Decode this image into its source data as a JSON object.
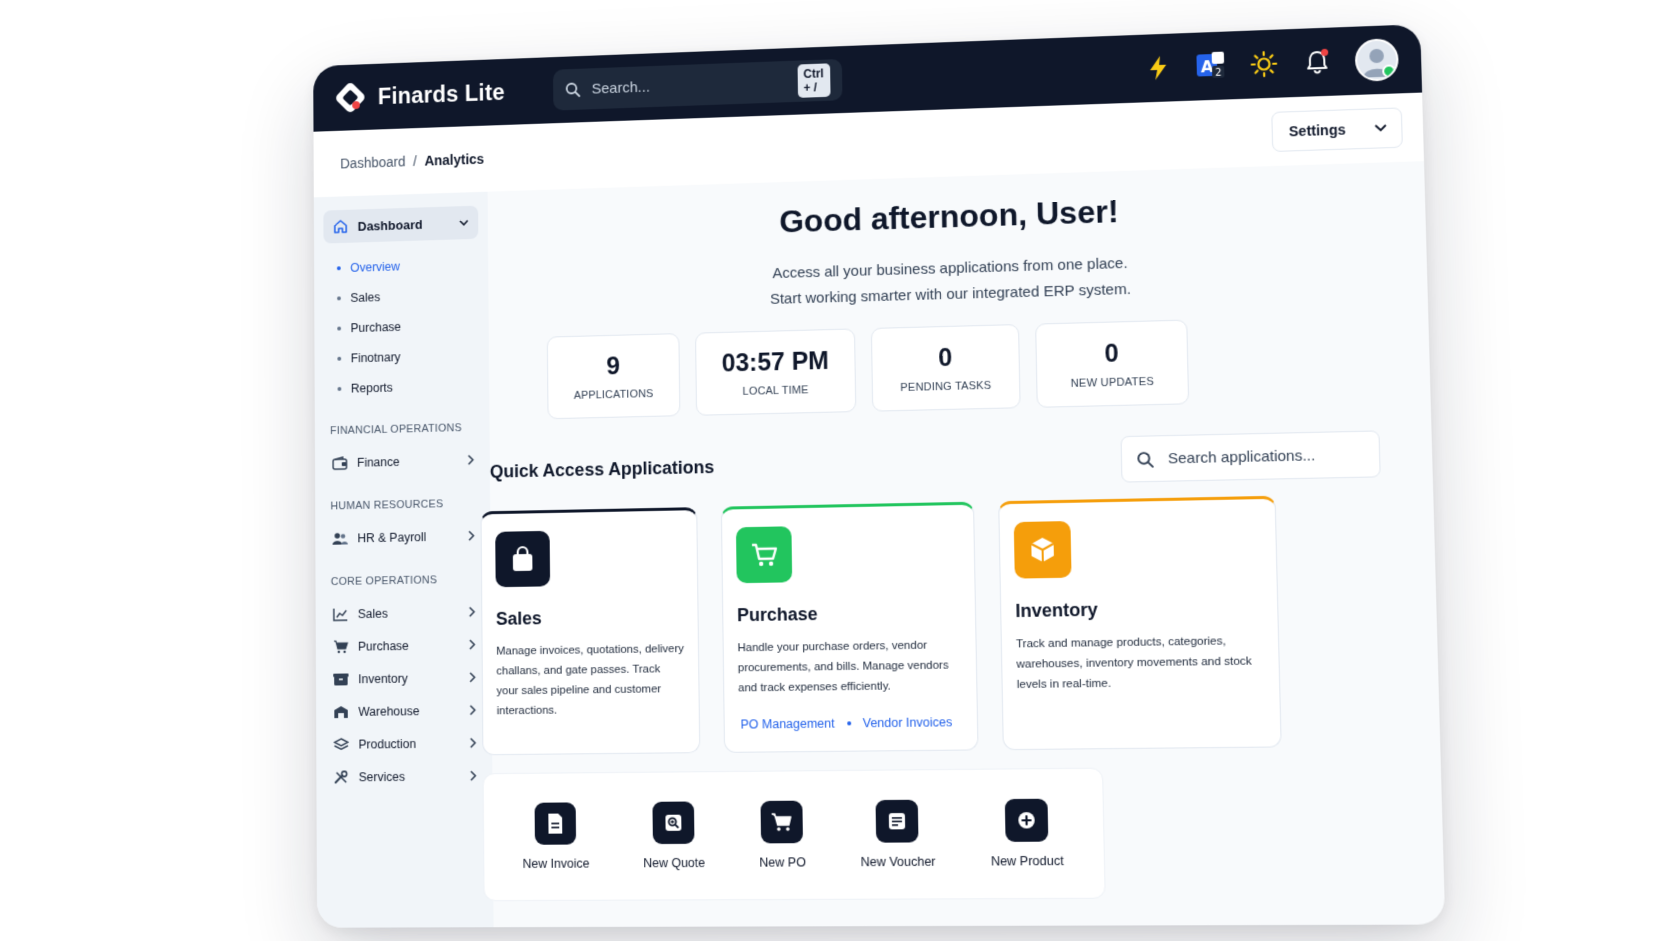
{
  "app": {
    "brand": "Finards Lite"
  },
  "search": {
    "placeholder": "Search...",
    "shortcut": "Ctrl + /"
  },
  "topbar_icons": [
    "lightning-icon",
    "language-icon",
    "sun-icon",
    "bell-icon"
  ],
  "breadcrumb": {
    "root": "Dashboard",
    "separator": "/",
    "current": "Analytics"
  },
  "settings": {
    "label": "Settings"
  },
  "sidebar": {
    "top": {
      "label": "Dashboard"
    },
    "sub_items": [
      "Overview",
      "Sales",
      "Purchase",
      "Finotnary",
      "Reports"
    ],
    "active_sub": "Overview",
    "sections": [
      {
        "label": "FINANCIAL OPERATIONS",
        "items": [
          {
            "label": "Finance",
            "icon": "wallet-icon"
          }
        ]
      },
      {
        "label": "HUMAN RESOURCES",
        "items": [
          {
            "label": "HR & Payroll",
            "icon": "users-icon"
          }
        ]
      },
      {
        "label": "CORE OPERATIONS",
        "items": [
          {
            "label": "Sales",
            "icon": "chart-icon"
          },
          {
            "label": "Purchase",
            "icon": "cart-icon"
          },
          {
            "label": "Inventory",
            "icon": "box-icon"
          },
          {
            "label": "Warehouse",
            "icon": "warehouse-icon"
          },
          {
            "label": "Production",
            "icon": "layers-icon"
          },
          {
            "label": "Services",
            "icon": "tools-icon"
          }
        ]
      }
    ]
  },
  "main": {
    "greeting": "Good afternoon, User!",
    "subtitle_1": "Access all your business applications from one place.",
    "subtitle_2": "Start working smarter with our integrated ERP system.",
    "stats": [
      {
        "value": "9",
        "label": "APPLICATIONS"
      },
      {
        "value": "03:57 PM",
        "label": "LOCAL TIME"
      },
      {
        "value": "0",
        "label": "PENDING TASKS"
      },
      {
        "value": "0",
        "label": "NEW UPDATES"
      }
    ],
    "quick_access_title": "Quick Access Applications",
    "app_search_placeholder": "Search applications...",
    "cards": [
      {
        "title": "Sales",
        "desc": "Manage invoices, quotations, delivery challans, and gate passes. Track your sales pipeline and customer interactions.",
        "accent": "#0f172a",
        "icon": "shopping-bag-icon"
      },
      {
        "title": "Purchase",
        "desc": "Handle your purchase orders, vendor procurements, and bills. Manage vendors and track expenses efficiently.",
        "accent": "#22c55e",
        "icon": "cart-icon",
        "links": [
          "PO Management",
          "Vendor Invoices"
        ]
      },
      {
        "title": "Inventory",
        "desc": "Track and manage products, categories, warehouses, inventory movements and stock levels in real-time.",
        "accent": "#f59e0b",
        "icon": "cube-icon"
      }
    ],
    "quick_actions": [
      "New Invoice",
      "New Quote",
      "New PO",
      "New Voucher",
      "New Product"
    ]
  },
  "colors": {
    "dark": "#0f172a",
    "accent_blue": "#2563eb",
    "green": "#22c55e",
    "orange": "#f59e0b"
  }
}
